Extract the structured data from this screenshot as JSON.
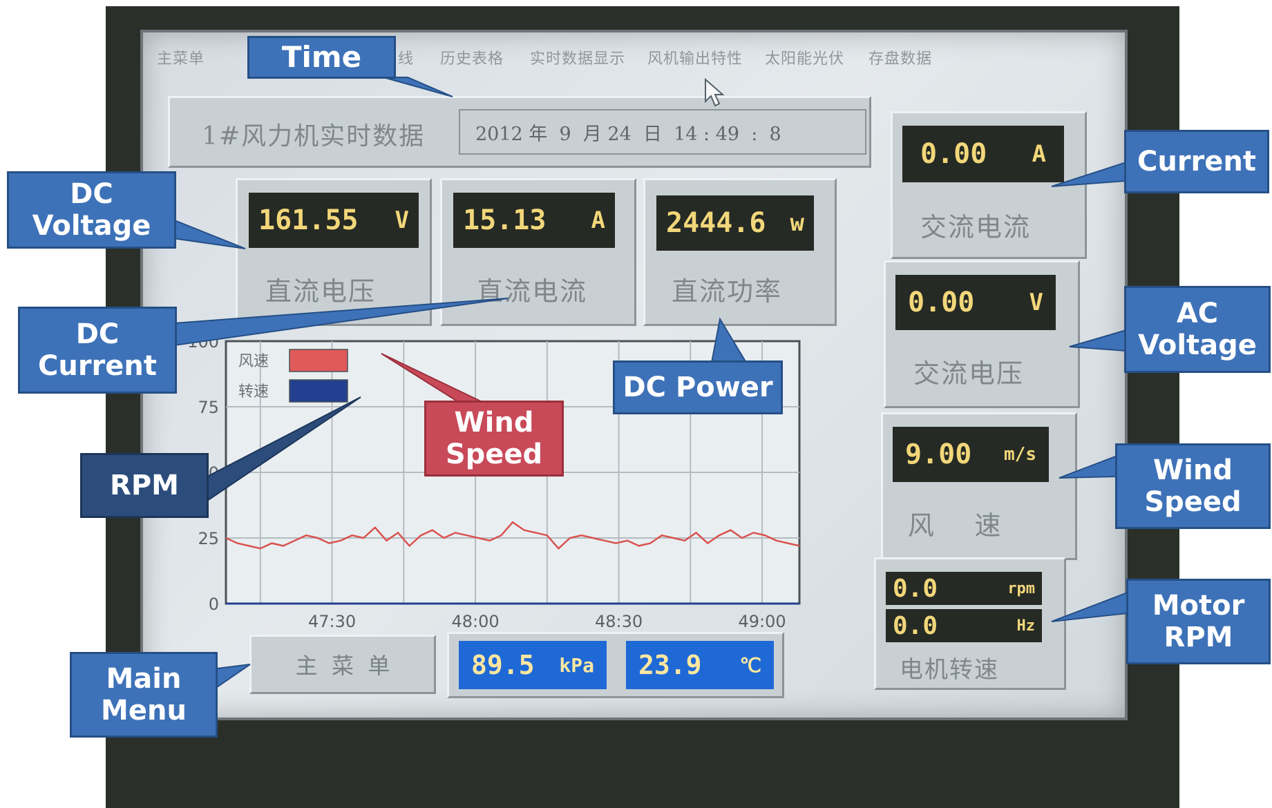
{
  "menu": {
    "items": [
      "主菜单",
      "实时曲线",
      "历史表格",
      "实时数据显示",
      "风机输出特性",
      "太阳能光伏",
      "存盘数据"
    ]
  },
  "header": {
    "title": "1#风力机实时数据",
    "datetime": "2012 年  9  月 24  日  14 : 49  :  8"
  },
  "dc": {
    "voltage": {
      "value": "161.55",
      "unit": "V",
      "label": "直流电压"
    },
    "current": {
      "value": "15.13",
      "unit": "A",
      "label": "直流电流"
    },
    "power": {
      "value": "2444.6",
      "unit": "w",
      "label": "直流功率"
    }
  },
  "ac": {
    "current": {
      "value": "0.00",
      "unit": "A",
      "label": "交流电流"
    },
    "voltage": {
      "value": "0.00",
      "unit": "V",
      "label": "交流电压"
    }
  },
  "wind": {
    "value": "9.00",
    "unit": "m/s",
    "label": "风    速"
  },
  "motor": {
    "rpm_value": "0.0",
    "rpm_unit": "rpm",
    "hz_value": "0.0",
    "hz_unit": "Hz",
    "label": "电机转速"
  },
  "footer": {
    "main_menu_label": "主  菜  单",
    "pressure": {
      "value": "89.5",
      "unit": "kPa"
    },
    "temperature": {
      "value": "23.9",
      "unit": "℃"
    }
  },
  "chart_data": {
    "type": "line",
    "title": "",
    "xlabel": "",
    "ylabel": "",
    "ylim": [
      0,
      100
    ],
    "yticks": [
      "0",
      "25",
      "50",
      "75",
      "100"
    ],
    "xticks": [
      {
        "t": 47.5,
        "label": "47:30"
      },
      {
        "t": 48.0,
        "label": "48:00"
      },
      {
        "t": 48.5,
        "label": "48:30"
      },
      {
        "t": 49.0,
        "label": "49:00"
      }
    ],
    "xlim": [
      47.13,
      49.13
    ],
    "grid": true,
    "legend": {
      "placement": "top-left",
      "entries": [
        {
          "label": "风速",
          "color": "#e05a5a"
        },
        {
          "label": "转速",
          "color": "#233f8f"
        }
      ]
    },
    "series": [
      {
        "name": "风速",
        "color": "#d9534f",
        "x": [
          47.13,
          47.17,
          47.21,
          47.25,
          47.29,
          47.33,
          47.37,
          47.41,
          47.45,
          47.49,
          47.53,
          47.57,
          47.61,
          47.65,
          47.69,
          47.73,
          47.77,
          47.81,
          47.85,
          47.89,
          47.93,
          47.97,
          48.01,
          48.05,
          48.09,
          48.13,
          48.17,
          48.21,
          48.25,
          48.29,
          48.33,
          48.37,
          48.41,
          48.45,
          48.49,
          48.53,
          48.57,
          48.61,
          48.65,
          48.69,
          48.73,
          48.77,
          48.81,
          48.85,
          48.89,
          48.93,
          48.97,
          49.01,
          49.05,
          49.09,
          49.13
        ],
        "values": [
          25,
          23,
          22,
          21,
          23,
          22,
          24,
          26,
          25,
          23,
          24,
          26,
          25,
          29,
          24,
          27,
          22,
          26,
          28,
          25,
          27,
          26,
          25,
          24,
          26,
          31,
          28,
          27,
          26,
          21,
          25,
          26,
          25,
          24,
          23,
          24,
          22,
          23,
          26,
          25,
          24,
          27,
          23,
          26,
          28,
          25,
          27,
          26,
          24,
          23,
          22
        ]
      },
      {
        "name": "转速",
        "color": "#233f8f",
        "x": [
          47.13,
          49.13
        ],
        "values": [
          0,
          0
        ]
      }
    ]
  },
  "callouts": {
    "time": "Time",
    "dc_voltage": "DC\nVoltage",
    "dc_current": "DC\nCurrent",
    "rpm": "RPM",
    "wind_speed_chart": "Wind\nSpeed",
    "dc_power": "DC Power",
    "current": "Current",
    "ac_voltage": "AC\nVoltage",
    "wind_speed": "Wind\nSpeed",
    "motor_rpm": "Motor\nRPM",
    "main_menu": "Main\nMenu"
  },
  "colors": {
    "callout_blue": "#3e72b8",
    "callout_dark": "#2c4d7c",
    "callout_red": "#c84a59",
    "lcd_text": "#f2d77a",
    "info_blue": "#1f69d6"
  }
}
